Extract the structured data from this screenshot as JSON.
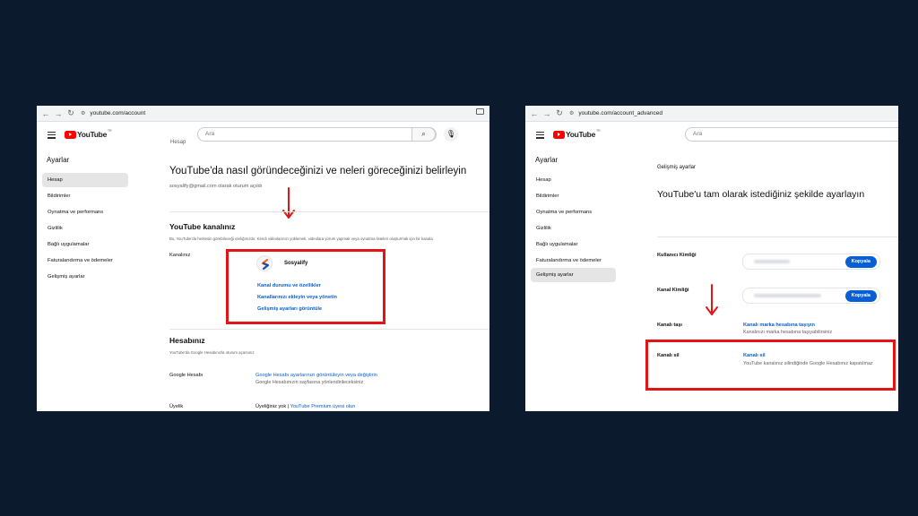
{
  "left": {
    "url": "youtube.com/account",
    "search_placeholder": "Ara",
    "logo_text": "YouTube",
    "logo_region": "TR",
    "sidebar_title": "Ayarlar",
    "sidebar": [
      "Hesap",
      "Bildirimler",
      "Oynatma ve performans",
      "Gizlilik",
      "Bağlı uygulamalar",
      "Faturalandırma ve ödemeler",
      "Gelişmiş ayarlar"
    ],
    "cut_top": "Hesap",
    "headline": "YouTube'da nasıl göründeceğinizi ve neleri göreceğinizi belirleyin",
    "signed_in": "sosyalify@gmail.com olarak oturum açıldı",
    "channel_title": "YouTube kanalınız",
    "channel_desc": "Bu, YouTube'da herkesin görebileceği varlığınızdır. Kendi videolarınızı yüklemek, videolara yorum yapmak veya oynatma listeleri oluşturmak için bir kanala",
    "channel_label": "Kanalınız",
    "channel_name": "Sosyalify",
    "channel_links": [
      "Kanal durumu ve özellikler",
      "Kanallarınızı ekleyin veya yönetin",
      "Gelişmiş ayarları görüntüle"
    ],
    "account_title": "Hesabınız",
    "account_desc": "YouTube'da Google Hesabınızla oturum açarsınız",
    "google_label": "Google Hesabı",
    "google_link": "Google Hesabı ayarlarınızı görüntüleyin veya değiştirin",
    "google_note": "Google Hesabınızın sayfasına yönlendirileceksiniz",
    "membership_label": "Üyelik",
    "membership_text": "Üyeliğiniz yok |",
    "membership_link": "YouTube Premium üyesi olun"
  },
  "right": {
    "url": "youtube.com/account_advanced",
    "search_placeholder": "Ara",
    "logo_text": "YouTube",
    "logo_region": "TR",
    "sidebar_title": "Ayarlar",
    "sidebar": [
      "Hesap",
      "Bildirimler",
      "Oynatma ve performans",
      "Gizlilik",
      "Bağlı uygulamalar",
      "Faturalandırma ve ödemeler",
      "Gelişmiş ayarlar"
    ],
    "section_title": "Gelişmiş ayarlar",
    "headline": "YouTube'u tam olarak istediğiniz şekilde ayarlayın",
    "user_id_label": "Kullanıcı Kimliği",
    "channel_id_label": "Kanal Kimliği",
    "copy_label": "Kopyala",
    "move_label": "Kanalı taşı",
    "move_link": "Kanalı marka hesabına taşıyın",
    "move_note": "Kanalınızı marka hesabına taşıyabilirsiniz",
    "delete_label": "Kanalı sil",
    "delete_link": "Kanalı sil",
    "delete_note": "YouTube kanalınız silindiğinde Google Hesabınız kapatılmaz"
  },
  "colors": {
    "background": "#0b1a2c",
    "highlight": "#e41414",
    "link": "#065fd4",
    "youtube_red": "#ff0000"
  }
}
